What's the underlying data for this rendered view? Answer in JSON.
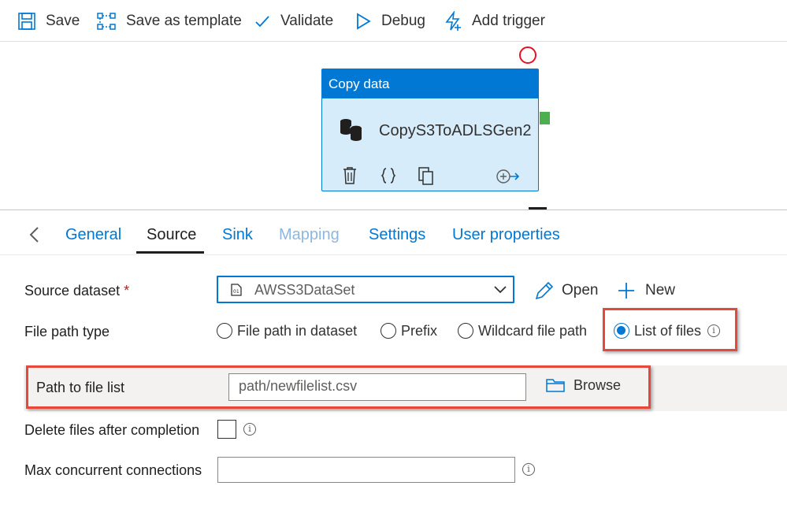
{
  "toolbar": {
    "save": "Save",
    "save_as_template": "Save as template",
    "validate": "Validate",
    "debug": "Debug",
    "add_trigger": "Add trigger"
  },
  "activity": {
    "header": "Copy data",
    "name": "CopyS3ToADLSGen2"
  },
  "tabs": {
    "general": "General",
    "source": "Source",
    "sink": "Sink",
    "mapping": "Mapping",
    "settings": "Settings",
    "user_properties": "User properties"
  },
  "form": {
    "source_dataset_label": "Source dataset",
    "required_mark": "*",
    "source_dataset_value": "AWSS3DataSet",
    "open_label": "Open",
    "new_label": "New",
    "file_path_type_label": "File path type",
    "radio_file_path_in_dataset": "File path in dataset",
    "radio_prefix": "Prefix",
    "radio_wildcard": "Wildcard file path",
    "radio_list_of_files": "List of files",
    "path_to_file_list_label": "Path to file list",
    "path_to_file_list_value": "path/newfilelist.csv",
    "browse_label": "Browse",
    "delete_files_label": "Delete files after completion",
    "max_connections_label": "Max concurrent connections",
    "max_connections_value": ""
  },
  "colors": {
    "accent": "#0078d4",
    "highlight": "#e8473b",
    "activity_bg": "#d7ecfa",
    "success_handle": "#4caf50",
    "failure_ring": "#e81123"
  }
}
